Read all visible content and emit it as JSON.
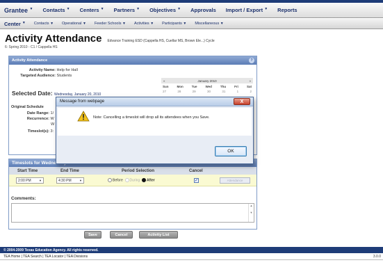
{
  "top_strip": {
    "text": ""
  },
  "nav1": {
    "items": [
      {
        "label": "Grantee"
      },
      {
        "label": "Contacts"
      },
      {
        "label": "Centers"
      },
      {
        "label": "Partners"
      },
      {
        "label": "Objectives"
      },
      {
        "label": "Approvals"
      },
      {
        "label": "Import / Export"
      },
      {
        "label": "Reports"
      }
    ]
  },
  "nav2": {
    "items": [
      {
        "label": "Center"
      },
      {
        "label": "Contacts"
      },
      {
        "label": "Operational"
      },
      {
        "label": "Feeder Schools"
      },
      {
        "label": "Activities"
      },
      {
        "label": "Participants"
      },
      {
        "label": "Miscellaneous"
      }
    ]
  },
  "page": {
    "title": "Activity Attendance",
    "context": "Edvance Training ESD (Cappella HS, Cuellar MS, Brown Ele...) Cycle",
    "subtitle": "6: Spring 2010 - C1 / Cappella HS"
  },
  "activity_panel": {
    "header": "Activity Attendance",
    "help": "?",
    "activity_name_label": "Activity Name:",
    "activity_name": "Help for Hall",
    "audience_label": "Targeted Audience:",
    "audience": "Students",
    "selected_date_label": "Selected Date:",
    "selected_date": "Wednesday, January 20, 2010",
    "original_schedule_label": "Original Schedule",
    "date_range_label": "Date Range:",
    "date_range": "1/",
    "recurrence_label": "Recurrence:",
    "recurrence_1": "W",
    "recurrence_2": "W",
    "timeslots_label": "Timeslot(s):",
    "timeslots": "3:"
  },
  "calendar": {
    "prev": "«",
    "month": "January 2010",
    "next": "»",
    "days": [
      "Sun",
      "Mon",
      "Tue",
      "Wed",
      "Thu",
      "Fri",
      "Sat"
    ],
    "week1": [
      "27",
      "28",
      "29",
      "30",
      "31",
      "1",
      "2"
    ]
  },
  "timeslots": {
    "header": "Timeslots for Wednesday",
    "columns": {
      "start": "Start Time",
      "end": "End Time",
      "period": "Period Selection",
      "cancel": "Cancel"
    },
    "row": {
      "start": "2:00 PM",
      "end": "4:30 PM",
      "before": "Before",
      "during": "During",
      "after": "After",
      "cancel_check": "✓",
      "attendance_btn": "Attendance"
    },
    "comments_label": "Comments:"
  },
  "buttons": {
    "save": "Save",
    "cancel": "Cancel",
    "activity_list": "Activity List"
  },
  "footer": {
    "copyright": "© 2004-2009 Texas Education Agency. All rights reserved.",
    "links": "TEA Home | TEA Search | TEA Locator | TEA Divisions",
    "version": "3.0.0"
  },
  "dialog": {
    "title": "Message from webpage",
    "close": "X",
    "message": "Note: Cancelling a timeslot will drop all its attendees when you Save.",
    "ok": "OK"
  }
}
